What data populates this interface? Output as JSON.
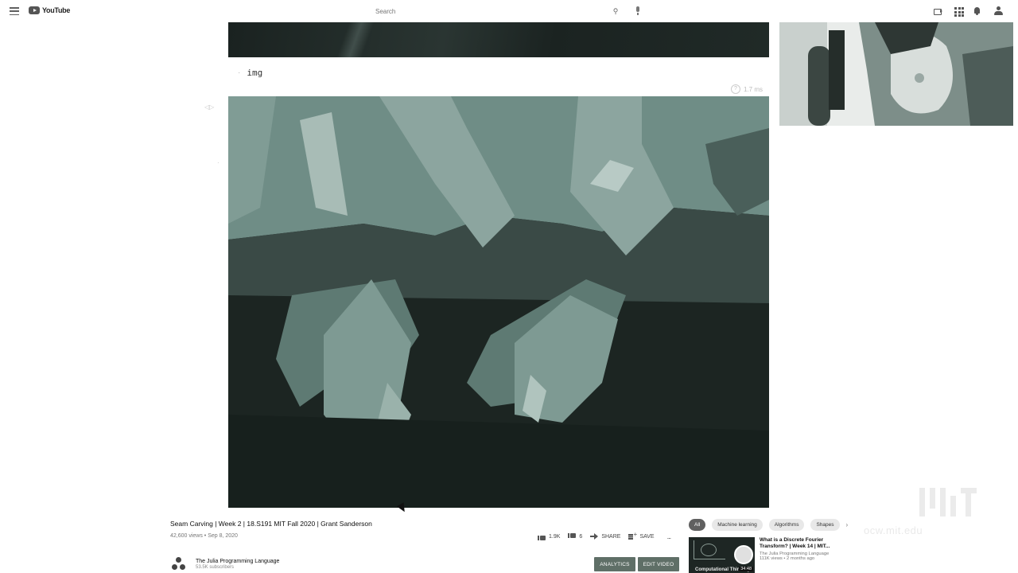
{
  "header": {
    "logo_text": "YouTube",
    "search_placeholder": "Search",
    "icons": [
      "menu-icon",
      "youtube-logo-icon",
      "search-icon",
      "mic-icon",
      "create-video-icon",
      "apps-icon",
      "notifications-bell-icon",
      "account-icon"
    ]
  },
  "player": {
    "markdown_text": "img",
    "cell_meta": "1.7 ms"
  },
  "video": {
    "title": "Seam Carving | Week 2 | 18.S191 MIT Fall 2020 | Grant Sanderson",
    "meta": "42,600 views • Sep 8, 2020",
    "likes": "1.9K",
    "dislikes": "6",
    "share_label": "SHARE",
    "save_label": "SAVE",
    "more_label": "..."
  },
  "channel": {
    "name": "The Julia Programming Language",
    "subscribers": "53.5K subscribers"
  },
  "buttons": {
    "analytics": "ANALYTICS",
    "edit_video": "EDIT VIDEO"
  },
  "chips": {
    "items": [
      "All",
      "Machine learning",
      "Algorithms",
      "Shapes"
    ],
    "active_index": 0
  },
  "recommended": {
    "title": "What is a Discrete Fourier Transform? | Week 14 | MIT...",
    "channel": "The Julia Programming Language",
    "views": "111K views • 2 months ago",
    "duration": "34:48",
    "thumb_label": "Computational Thinking"
  },
  "watermark": {
    "logo": "MIT",
    "url": "ocw.mit.edu"
  }
}
